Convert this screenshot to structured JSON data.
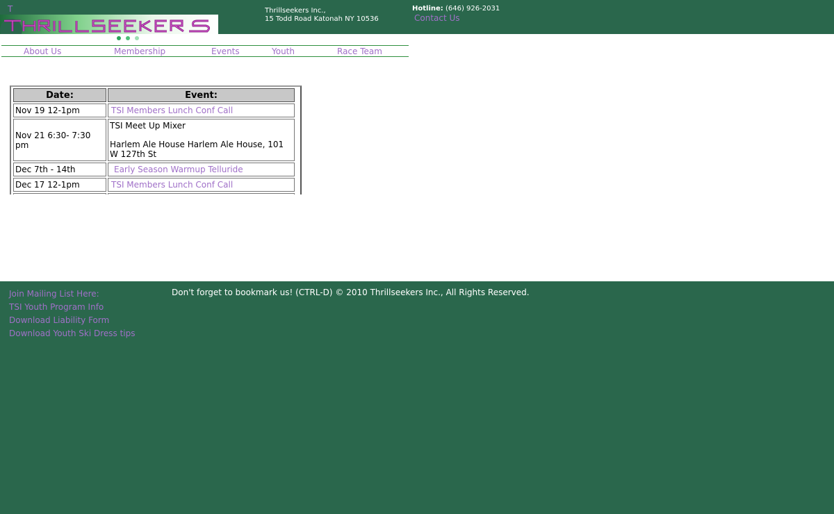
{
  "header": {
    "stray_text": "T",
    "logo_text": "THRILLSEEKERS",
    "company_name": "Thrillseekers Inc.,",
    "address": "15 Todd Road Katonah NY 10536",
    "hotline_label": "Hotline:",
    "hotline_number": "(646) 926-2031",
    "contact_label": "Contact Us"
  },
  "nav": {
    "items": [
      {
        "label": "About Us"
      },
      {
        "label": "Membership"
      },
      {
        "label": "Events"
      },
      {
        "label": "Youth"
      },
      {
        "label": "Race Team"
      }
    ]
  },
  "events": {
    "headers": [
      "Date:",
      "Event:"
    ],
    "rows": [
      {
        "date": "Nov 19 12-1pm",
        "event": "TSI Members Lunch Conf Call",
        "event_detail": ""
      },
      {
        "date": "Nov 21 6:30- 7:30 pm",
        "event": "TSI Meet Up Mixer",
        "event_detail": "Harlem Ale House Harlem Ale House, 101 W 127th St"
      },
      {
        "date": "Dec 7th - 14th",
        "event": "Early Season Warmup Telluride",
        "event_detail": ""
      },
      {
        "date": "Dec 17 12-1pm",
        "event": "TSI Members Lunch Conf Call",
        "event_detail": ""
      }
    ]
  },
  "footer": {
    "links": [
      {
        "label": "Join Mailing List Here:"
      },
      {
        "label": "TSI Youth Program Info"
      },
      {
        "label": "Download Liability Form"
      },
      {
        "label": "Download Youth Ski Dress tips"
      }
    ],
    "copyright": "Don't forget to bookmark us! (CTRL-D) © 2010 Thrillseekers Inc., All Rights Reserved."
  },
  "colors": {
    "brand_green": "#2a674c",
    "link_purple": "#a070c8",
    "logo_magenta": "#c030b8"
  }
}
